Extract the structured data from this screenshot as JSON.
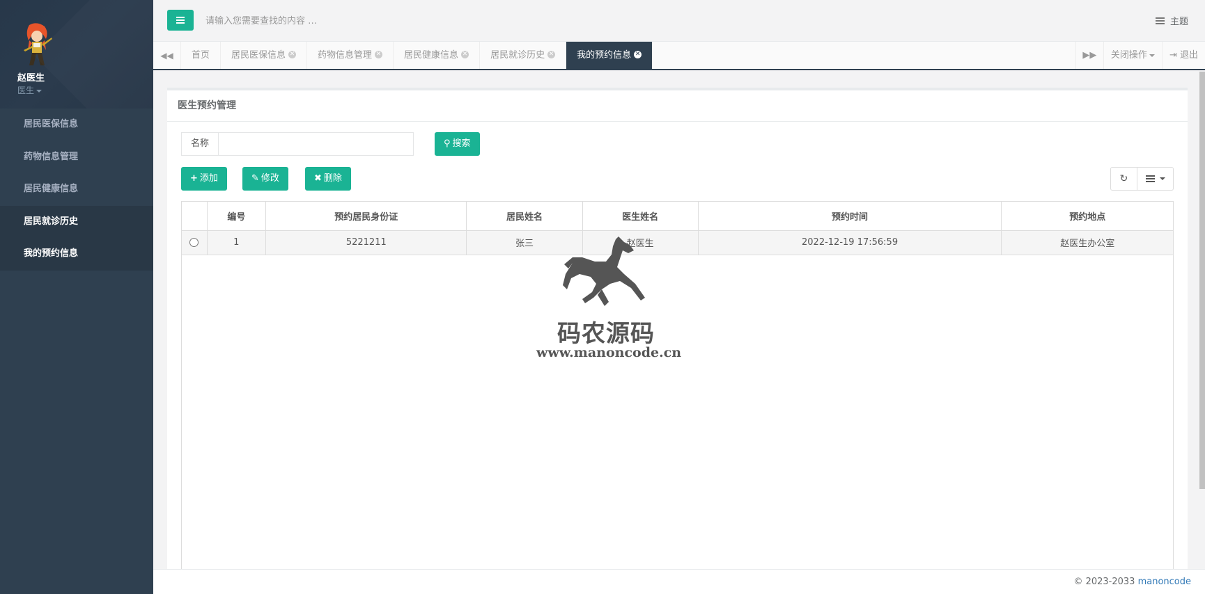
{
  "user": {
    "name": "赵医生",
    "role": "医生"
  },
  "sidebar": {
    "items": [
      {
        "label": "居民医保信息"
      },
      {
        "label": "药物信息管理"
      },
      {
        "label": "居民健康信息"
      },
      {
        "label": "居民就诊历史"
      },
      {
        "label": "我的预约信息"
      }
    ]
  },
  "topbar": {
    "search_placeholder": "请输入您需要查找的内容 …",
    "theme_label": "主题"
  },
  "tabs": {
    "items": [
      {
        "label": "首页"
      },
      {
        "label": "居民医保信息"
      },
      {
        "label": "药物信息管理"
      },
      {
        "label": "居民健康信息"
      },
      {
        "label": "居民就诊历史"
      },
      {
        "label": "我的预约信息"
      }
    ],
    "close_ops": "关闭操作",
    "logout": "退出"
  },
  "panel": {
    "title": "医生预约管理",
    "search_label": "名称",
    "search_value": "",
    "search_button": "搜索",
    "add_button": "添加",
    "edit_button": "修改",
    "delete_button": "删除"
  },
  "table": {
    "headers": [
      "编号",
      "预约居民身份证",
      "居民姓名",
      "医生姓名",
      "预约时间",
      "预约地点"
    ],
    "rows": [
      [
        "1",
        "5221211",
        "张三",
        "赵医生",
        "2022-12-19 17:56:59",
        "赵医生办公室"
      ]
    ]
  },
  "watermark": {
    "text": "码农源码",
    "url": "www.manoncode.cn"
  },
  "footer": {
    "copyright": "© 2023-2033",
    "link": "manoncode"
  },
  "colors": {
    "primary": "#1ab394",
    "sidebar": "#2f4050",
    "link": "#337ab7"
  }
}
